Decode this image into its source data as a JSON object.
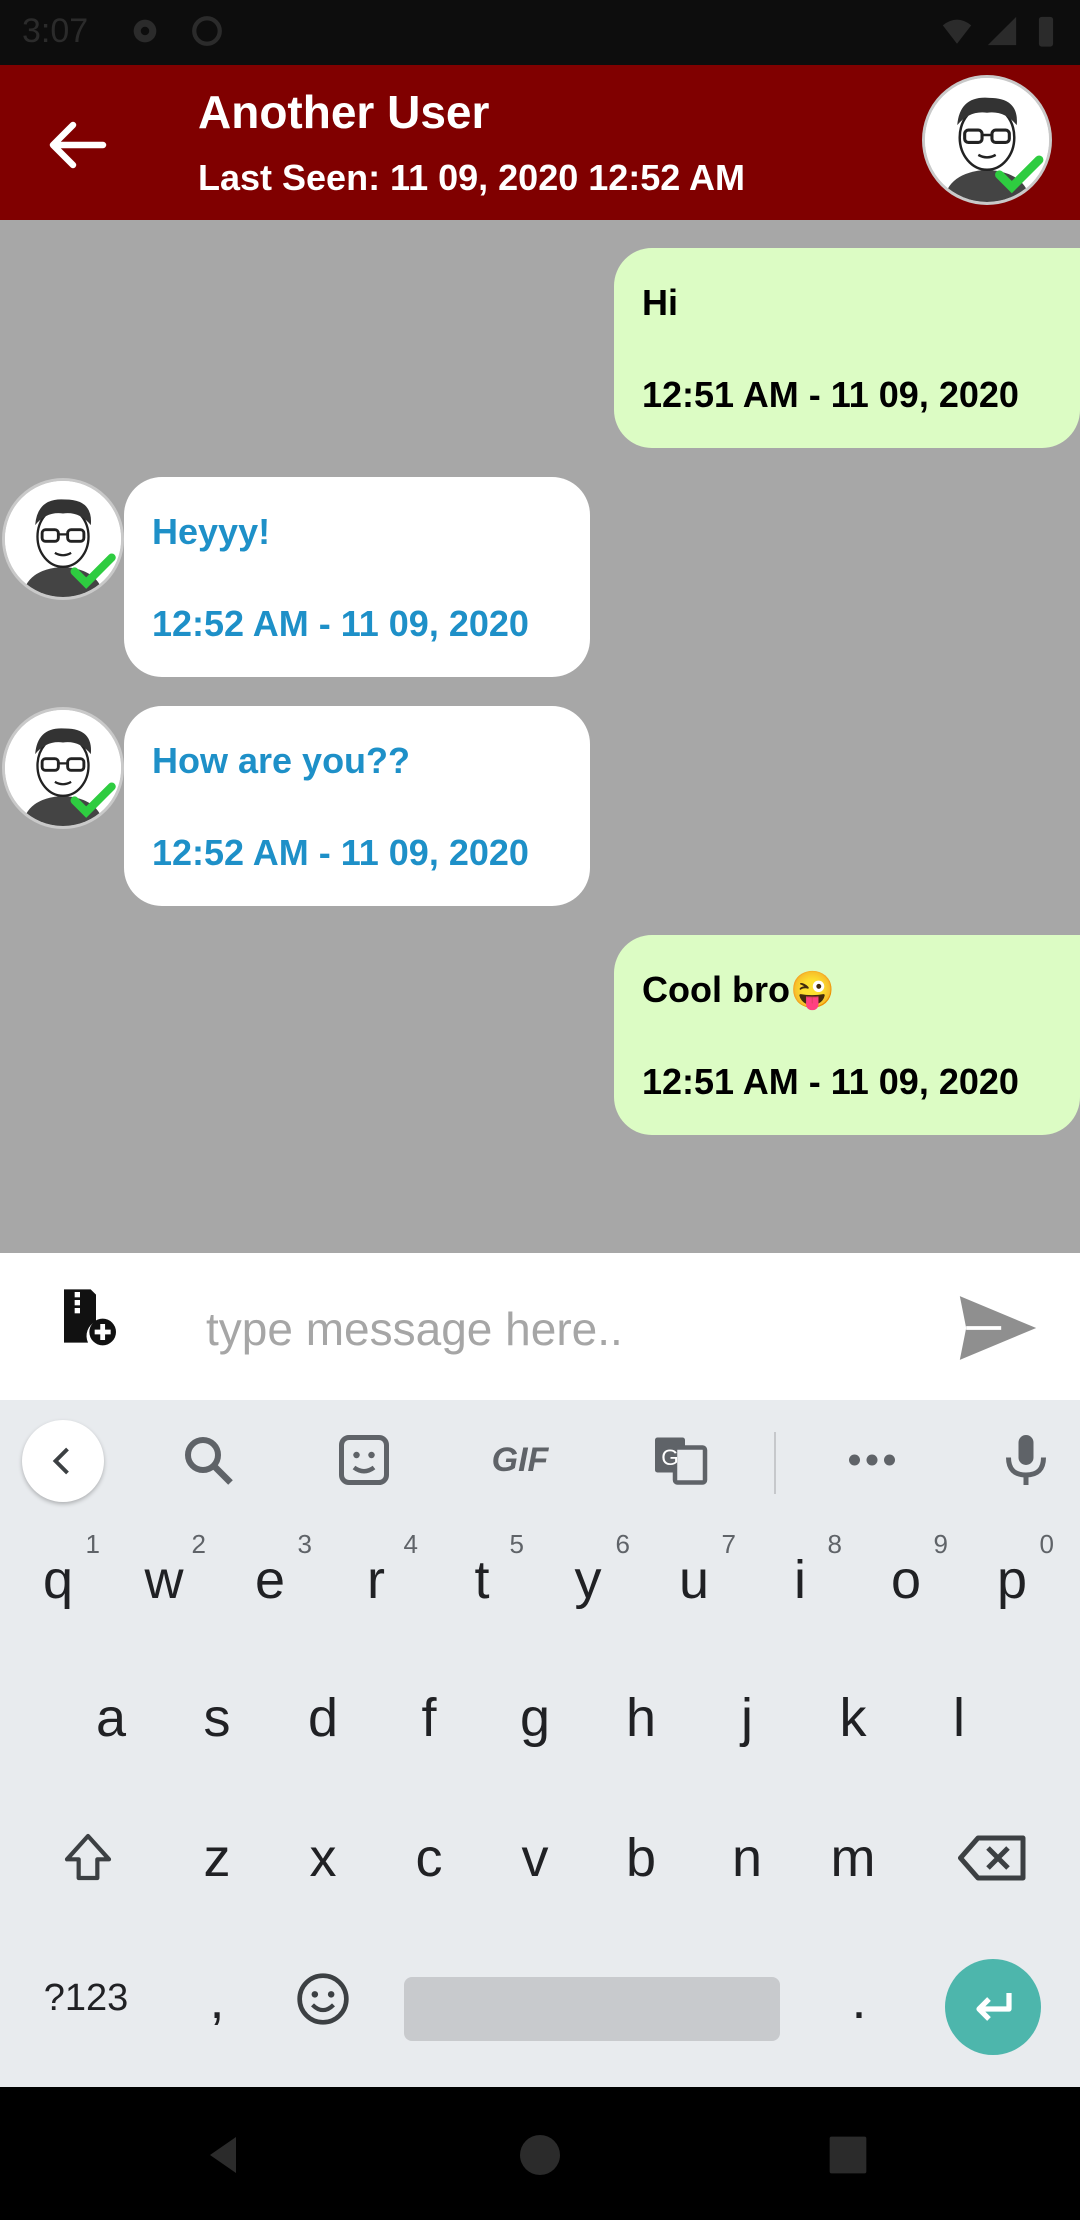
{
  "status_bar": {
    "time": "3:07"
  },
  "header": {
    "name": "Another User",
    "last_seen": "Last Seen: 11 09, 2020 12:52 AM"
  },
  "messages": [
    {
      "direction": "outgoing",
      "text": "Hi",
      "timestamp": "12:51 AM - 11 09, 2020"
    },
    {
      "direction": "incoming",
      "text": "Heyyy!",
      "timestamp": "12:52 AM - 11 09, 2020"
    },
    {
      "direction": "incoming",
      "text": "How are you??",
      "timestamp": "12:52 AM - 11 09, 2020"
    },
    {
      "direction": "outgoing",
      "text": "Cool bro😜",
      "timestamp": "12:51 AM - 11 09, 2020"
    }
  ],
  "composer": {
    "placeholder": "type message here.."
  },
  "keyboard": {
    "toolbar": {
      "gif": "GIF"
    },
    "row1": [
      {
        "k": "q",
        "n": "1"
      },
      {
        "k": "w",
        "n": "2"
      },
      {
        "k": "e",
        "n": "3"
      },
      {
        "k": "r",
        "n": "4"
      },
      {
        "k": "t",
        "n": "5"
      },
      {
        "k": "y",
        "n": "6"
      },
      {
        "k": "u",
        "n": "7"
      },
      {
        "k": "i",
        "n": "8"
      },
      {
        "k": "o",
        "n": "9"
      },
      {
        "k": "p",
        "n": "0"
      }
    ],
    "row2": [
      "a",
      "s",
      "d",
      "f",
      "g",
      "h",
      "j",
      "k",
      "l"
    ],
    "row3": [
      "z",
      "x",
      "c",
      "v",
      "b",
      "n",
      "m"
    ],
    "symbols_label": "?123",
    "comma": ",",
    "period": "."
  },
  "colors": {
    "header_bg": "#800000",
    "chat_bg": "#a7a7a7",
    "outgoing_bubble": "#dcfcc4",
    "incoming_bubble": "#ffffff",
    "incoming_text": "#1e90c8",
    "enter_key": "#4db6ac"
  },
  "icons": {
    "back": "arrow-left-icon",
    "attach": "attach-file-icon",
    "send": "send-icon",
    "avatar": "avatar-glasses-check"
  }
}
